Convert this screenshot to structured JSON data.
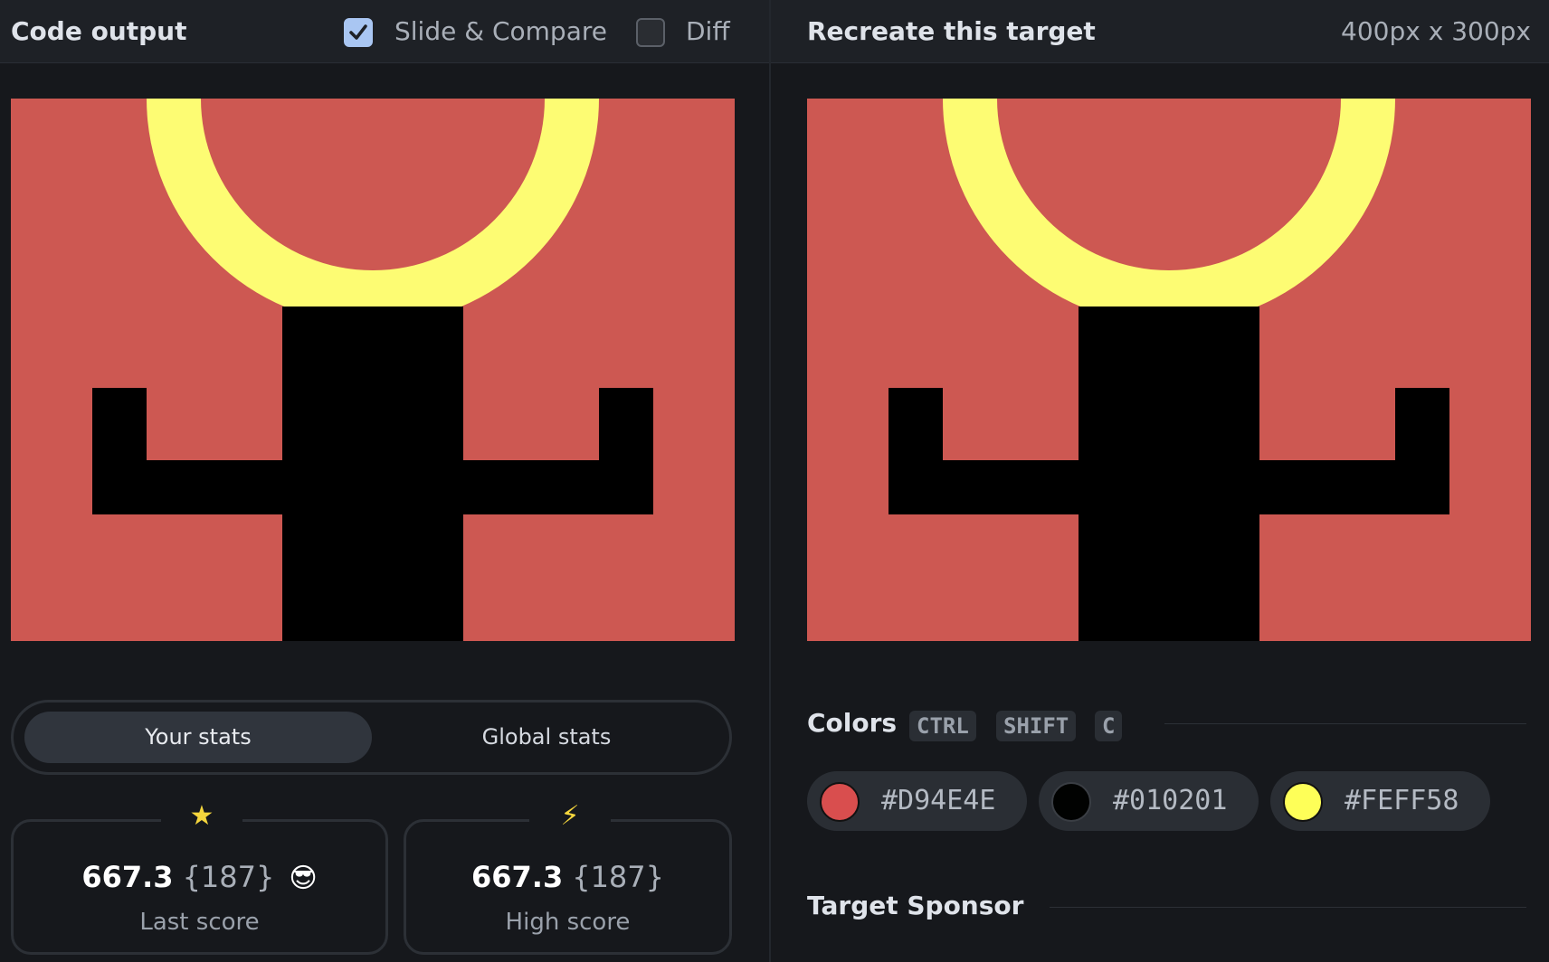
{
  "left_panel": {
    "title": "Code output",
    "slide_compare": {
      "label": "Slide & Compare",
      "checked": true
    },
    "diff": {
      "label": "Diff",
      "checked": false
    },
    "stats_tabs": [
      "Your stats",
      "Global stats"
    ],
    "stats": [
      {
        "icon": "star-icon",
        "glyph": "★",
        "score": "667.3",
        "count": "{187}",
        "emoji": "😎",
        "label": "Last score"
      },
      {
        "icon": "lightning-icon",
        "glyph": "⚡",
        "score": "667.3",
        "count": "{187}",
        "emoji": "",
        "label": "High score"
      }
    ]
  },
  "right_panel": {
    "title": "Recreate this target",
    "dimensions": "400px x 300px",
    "colors_title": "Colors",
    "shortcut_keys": [
      "CTRL",
      "SHIFT",
      "C"
    ],
    "colors": [
      {
        "hex": "#D94E4E"
      },
      {
        "hex": "#010201"
      },
      {
        "hex": "#FEFF58"
      }
    ],
    "sponsor_title": "Target Sponsor"
  },
  "palette": {
    "canvas_background": "#cd5852",
    "figure_black": "#000000",
    "ring_yellow": "#fdfc73",
    "accent_check": "#a9c6f2",
    "star_yellow": "#f5d63d"
  }
}
